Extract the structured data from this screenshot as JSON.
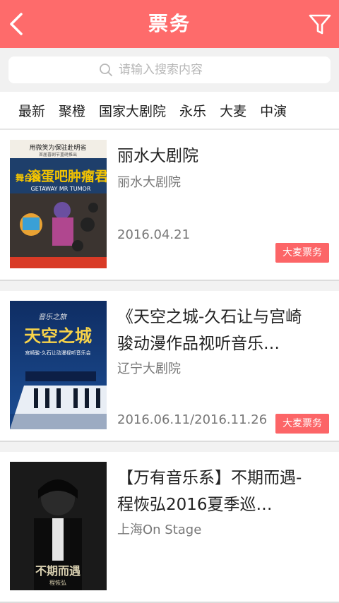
{
  "header": {
    "title": "票务",
    "back_icon": "chevron-left-icon",
    "filter_icon": "filter-icon",
    "bg_color": "#fe6b6b"
  },
  "search": {
    "placeholder": "请输入搜索内容",
    "icon": "search-icon"
  },
  "tabs": [
    {
      "label": "最新"
    },
    {
      "label": "聚橙"
    },
    {
      "label": "国家大剧院"
    },
    {
      "label": "永乐"
    },
    {
      "label": "大麦"
    },
    {
      "label": "中演"
    }
  ],
  "events": [
    {
      "title": "丽水大剧院",
      "venue": "丽水大剧院",
      "date": "2016.04.21",
      "badge": "大麦票务",
      "poster": {
        "top_text": "用微笑为保驻赴明省",
        "sub_text": "首届喜剧节重磅推出",
        "main_text": "滚蛋吧肿瘤君",
        "side_text": "舞台剧",
        "en_text": "GETAWAY MR TUMOR"
      }
    },
    {
      "title": "《天空之城-久石让与宫崎骏动漫作品视听音乐…",
      "venue": "辽宁大剧院",
      "date": "2016.06.11/2016.11.26",
      "badge": "大麦票务",
      "poster": {
        "script_text": "音乐之旅",
        "main_text": "天空之城",
        "sub_text": "宫崎骏·久石让动漫视听音乐会"
      }
    },
    {
      "title": "【万有音乐系】不期而遇-程恢弘2016夏季巡…",
      "venue": "上海On Stage",
      "date": "",
      "badge": "",
      "poster": {
        "main_text": "不期而遇",
        "sub_text": "程恢弘"
      }
    }
  ]
}
